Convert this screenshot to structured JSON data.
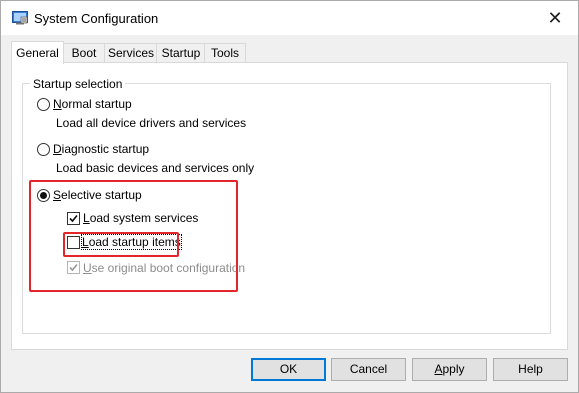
{
  "window": {
    "title": "System Configuration",
    "close_glyph": "✕"
  },
  "tabs": [
    {
      "label": "General",
      "active": true
    },
    {
      "label": "Boot",
      "active": false
    },
    {
      "label": "Services",
      "active": false
    },
    {
      "label": "Startup",
      "active": false
    },
    {
      "label": "Tools",
      "active": false
    }
  ],
  "startup_selection": {
    "legend": "Startup selection",
    "normal": {
      "access_key": "N",
      "label_rest": "ormal startup",
      "description": "Load all device drivers and services",
      "selected": false
    },
    "diagnostic": {
      "access_key": "D",
      "label_rest": "iagnostic startup",
      "description": "Load basic devices and services only",
      "selected": false
    },
    "selective": {
      "access_key": "S",
      "label_rest": "elective startup",
      "selected": true,
      "load_system_services": {
        "access_key": "L",
        "label_rest": "oad system services",
        "checked": true,
        "enabled": true
      },
      "load_startup_items": {
        "access_key": "L",
        "label_rest": "oad startup items",
        "checked": false,
        "enabled": true
      },
      "use_original_boot": {
        "access_key": "U",
        "label_rest": "se original boot configuration",
        "checked": true,
        "enabled": false
      }
    }
  },
  "buttons": {
    "ok": "OK",
    "cancel": "Cancel",
    "apply_key": "A",
    "apply_rest": "pply",
    "help": "Help"
  },
  "colors": {
    "highlight": "#e3262b",
    "default_button_border": "#0078d7"
  },
  "icons": {
    "app": "system-configuration-icon",
    "close": "close-icon",
    "check": "checkmark-icon"
  }
}
